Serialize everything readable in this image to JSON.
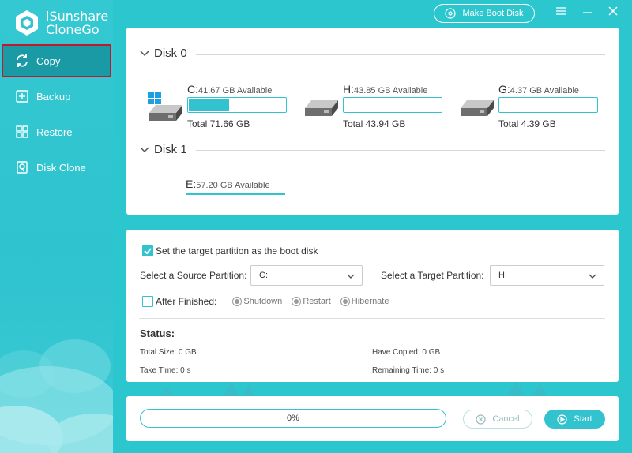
{
  "app": {
    "name_line1": "iSunshare",
    "name_line2": "CloneGo",
    "make_boot_disk": "Make Boot Disk",
    "accent": "#33c3cf",
    "highlight": "#c0182c"
  },
  "sidebar": {
    "items": [
      {
        "label": "Copy",
        "icon": "copy-sync-icon",
        "active": true
      },
      {
        "label": "Backup",
        "icon": "backup-icon"
      },
      {
        "label": "Restore",
        "icon": "restore-icon"
      },
      {
        "label": "Disk Clone",
        "icon": "disk-clone-icon"
      }
    ]
  },
  "disks": [
    {
      "name": "Disk 0",
      "partitions": [
        {
          "letter": "C:",
          "available": "41.67 GB Available",
          "total": "Total 71.66 GB",
          "used_fraction": 0.42,
          "system": true
        },
        {
          "letter": "H:",
          "available": "43.85 GB Available",
          "total": "Total 43.94 GB",
          "used_fraction": 0.0
        },
        {
          "letter": "G:",
          "available": "4.37 GB Available",
          "total": "Total 4.39 GB",
          "used_fraction": 0.0
        }
      ]
    },
    {
      "name": "Disk 1",
      "partitions": [
        {
          "letter": "E:",
          "available": "57.20 GB Available"
        }
      ]
    }
  ],
  "options": {
    "boot_checkbox_label": "Set the target partition as the boot disk",
    "boot_checked": true,
    "source_label": "Select a Source Partition:",
    "source_value": "C:",
    "target_label": "Select a Target Partition:",
    "target_value": "H:",
    "after_label": "After Finished:",
    "after_checked": false,
    "after_options": [
      "Shutdown",
      "Restart",
      "Hibernate"
    ]
  },
  "status": {
    "title": "Status:",
    "total_size": "Total Size: 0 GB",
    "have_copied": "Have Copied: 0 GB",
    "take_time": "Take Time: 0 s",
    "remaining_time": "Remaining Time: 0 s"
  },
  "progress": {
    "percent_label": "0%",
    "cancel": "Cancel",
    "start": "Start"
  }
}
